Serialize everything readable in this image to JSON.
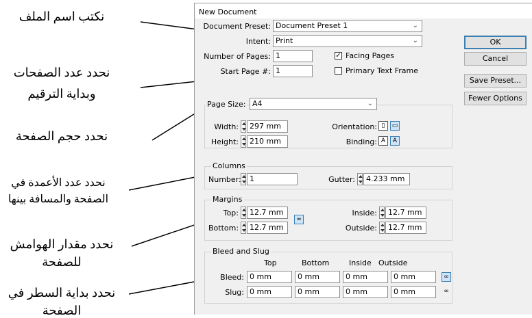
{
  "annotations": {
    "filename": "نكتب اسم الملف",
    "pages_1": "نحدد عدد الصفحات",
    "pages_2": "وبداية الترقيم",
    "page_size": "نحدد حجم الصفحة",
    "columns_1": "نحدد عدد الأعمدة في",
    "columns_2": "الصفحة والمسافة بينها",
    "margins_1": "نحدد مقدار الهوامش",
    "margins_2": "للصفحة",
    "bleed_1": "نحدد بداية السطر في",
    "bleed_2": "الصفحة"
  },
  "dialog": {
    "title": "New Document",
    "preset": {
      "label": "Document Preset:",
      "value": "Document Preset 1"
    },
    "intent": {
      "label": "Intent:",
      "value": "Print"
    },
    "num_pages": {
      "label": "Number of Pages:",
      "value": "1"
    },
    "start_page": {
      "label": "Start Page #:",
      "value": "1"
    },
    "facing_pages": {
      "label": "Facing Pages",
      "checked": true
    },
    "primary_text_frame": {
      "label": "Primary Text Frame",
      "checked": false
    },
    "page_size": {
      "label": "Page Size:",
      "value": "A4",
      "width_label": "Width:",
      "width": "297 mm",
      "height_label": "Height:",
      "height": "210 mm",
      "orientation_label": "Orientation:",
      "binding_label": "Binding:"
    },
    "columns": {
      "title": "Columns",
      "number_label": "Number:",
      "number": "1",
      "gutter_label": "Gutter:",
      "gutter": "4.233 mm"
    },
    "margins": {
      "title": "Margins",
      "top_label": "Top:",
      "top": "12.7 mm",
      "bottom_label": "Bottom:",
      "bottom": "12.7 mm",
      "inside_label": "Inside:",
      "inside": "12.7 mm",
      "outside_label": "Outside:",
      "outside": "12.7 mm"
    },
    "bleed_slug": {
      "title": "Bleed and Slug",
      "headers": [
        "Top",
        "Bottom",
        "Inside",
        "Outside"
      ],
      "bleed_label": "Bleed:",
      "bleed": [
        "0 mm",
        "0 mm",
        "0 mm",
        "0 mm"
      ],
      "slug_label": "Slug:",
      "slug": [
        "0 mm",
        "0 mm",
        "0 mm",
        "0 mm"
      ]
    },
    "buttons": {
      "ok": "OK",
      "cancel": "Cancel",
      "save_preset": "Save Preset...",
      "fewer_options": "Fewer Options"
    }
  },
  "colors": {
    "accent": "#3c7fb1",
    "dialog_bg": "#f0f0f0"
  }
}
